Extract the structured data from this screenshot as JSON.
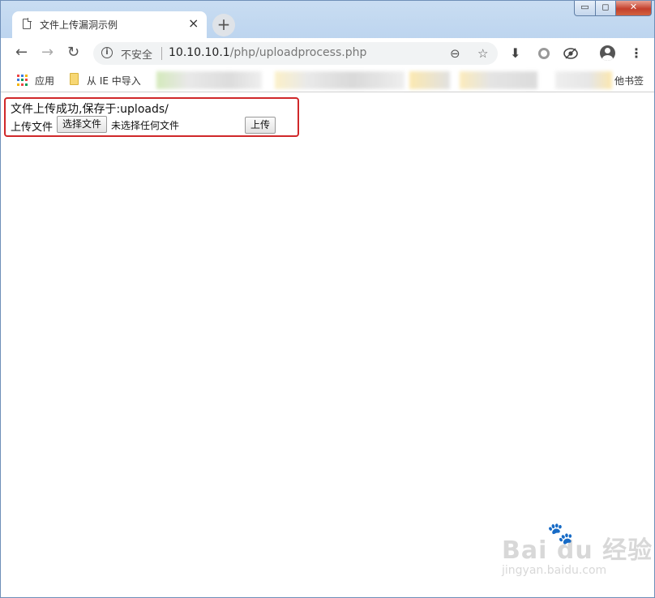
{
  "tab": {
    "title": "文件上传漏洞示例",
    "close": "×",
    "new_tab": "+"
  },
  "window_controls": {
    "minimize": "▭",
    "maximize": "◻",
    "close": "✕"
  },
  "toolbar": {
    "back": "←",
    "forward": "→",
    "reload": "↻",
    "security_label": "不安全",
    "url_host": "10.10.10.1",
    "url_path": "/php/uploadprocess.php",
    "zoom_icon": "⊖",
    "star_icon": "☆",
    "download_icon": "⬇",
    "menu_icon": "⋮"
  },
  "bookmarks": {
    "apps_label": "应用",
    "ie_import_label": "从 IE 中导入",
    "overflow_label": "他书签"
  },
  "page": {
    "message": "文件上传成功,保存于:uploads/",
    "upload_label": "上传文件",
    "choose_file_button": "选择文件",
    "no_file_text": "未选择任何文件",
    "submit_button": "上传"
  },
  "watermark": {
    "brand": "Bai du 经验",
    "url": "jingyan.baidu.com"
  },
  "colors": {
    "highlight_border": "#d0282a",
    "window_frame": "#b9d2ee",
    "close_button": "#c4402d"
  }
}
